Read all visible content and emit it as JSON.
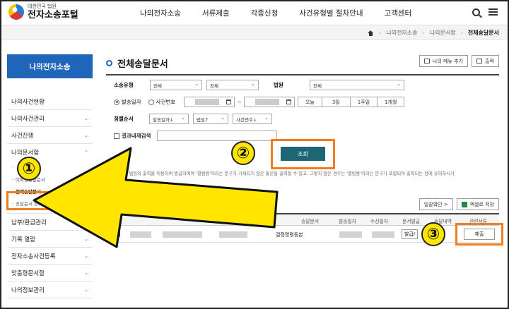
{
  "header": {
    "logo_sub": "대한민국 법원",
    "logo_main": "전자소송포털",
    "nav": [
      "나의전자소송",
      "서류제출",
      "각종신청",
      "사건유형별 절차안내",
      "고객센터"
    ]
  },
  "breadcrumb": [
    "나의전자소송",
    "나의문서함",
    "전체송달문서"
  ],
  "sidebar": {
    "title": "나의전자소송",
    "items": [
      {
        "label": "나의사건현황",
        "chev": ""
      },
      {
        "label": "나의사건관리",
        "chev": "⌄"
      },
      {
        "label": "사건진행",
        "chev": "⌄"
      },
      {
        "label": "나의문서함",
        "chev": "⌃"
      }
    ],
    "sub_items": [
      "",
      "미확인송달문서",
      "전체송달문서",
      "송달문서 정(등)본발급"
    ],
    "items_after": [
      {
        "label": "납부/환급관리",
        "chev": "⌄"
      },
      {
        "label": "기록 열람",
        "chev": "⌄"
      },
      {
        "label": "전자소송사건등록",
        "chev": "⌄"
      },
      {
        "label": "맞춤형문서함",
        "chev": "⌄"
      },
      {
        "label": "나의정보관리",
        "chev": "⌄"
      }
    ]
  },
  "main": {
    "title": "전체송달문서",
    "menu_add": "나의 메뉴 추가",
    "print": "출력",
    "form": {
      "case_type_label": "소송유형",
      "case_type_1": "전체",
      "case_type_2": "전체",
      "court_label": "법원",
      "court_value": "전체",
      "radio_date": "발송일자",
      "radio_case": "사건번호",
      "date_sep": "~",
      "periods": [
        "오늘",
        "3일",
        "1주일",
        "1개월"
      ],
      "sort_label": "정렬순서",
      "sort_1": "발송일자↓",
      "sort_2": "법원↑",
      "sort_3": "사건번호↓",
      "research_label": "결과내재검색",
      "search_btn": "조회"
    },
    "notice": "※ 대한민국 법원의 출력을 이용하여 발급하여야 '열람용'이라는 문구가 기재되지 않은 통본을 출력할 수 있고, 그렇지 않은 경우는 '열람용'이라는 문구가 포함되어 출력되는 점에 유의하시기",
    "confirm_btn": "일괄확인 >",
    "excel_btn": "엑셀로 저장",
    "table": {
      "headers": [
        "송달문서",
        "발송일자",
        "수신일자",
        "문서발급",
        "송달내역",
        "관련서류"
      ],
      "row": {
        "doc": "결정명령등본",
        "issue": "발급/",
        "submit": "제출"
      }
    }
  },
  "annotations": {
    "badge1": "①",
    "badge2": "②",
    "badge3": "③"
  },
  "colors": {
    "primary": "#1f66b9",
    "search_button": "#1d6675",
    "highlight": "#f27d1c",
    "arrow": "#ffe600"
  }
}
